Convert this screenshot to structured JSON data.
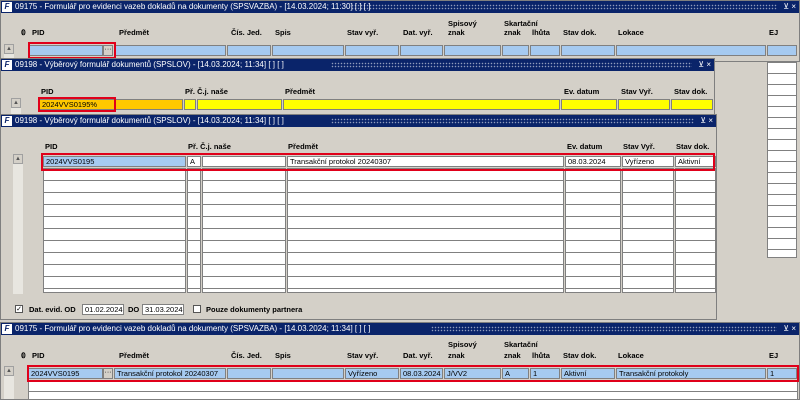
{
  "win_top": {
    "title": "09175 - Formulář pro evidenci vazeb dokladů na dokumenty (SPSVAZBA) - [14.03.2024; 11:30]  [ ]  [ ]",
    "icons": "⊻ ×",
    "headers": {
      "pid": "PID",
      "predmet": "Předmět",
      "cis_jed": "Čís. Jed.",
      "spis": "Spis",
      "stav_vyr": "Stav vyř.",
      "dat_vyr": "Dat. vyř.",
      "spisovy": "Spisový",
      "znak": "znak",
      "skartacni": "Skartační",
      "znak2": "znak",
      "lhuta": "lhůta",
      "stav_dok": "Stav dok.",
      "lokace": "Lokace",
      "ej": "EJ"
    },
    "pid_value": "",
    "ellipsis": "···"
  },
  "win_mid1": {
    "title": "09198 - Výběrový formulář dokumentů (SPSLOV) - [14.03.2024; 11:34]  [ ]  [ ]",
    "icons": "⊻ ×",
    "headers": {
      "pid": "PID",
      "pr_cj": "Př. Č.j. naše",
      "predmet": "Předmět",
      "ev_datum": "Ev. datum",
      "stav_vyr": "Stav Vyř.",
      "stav_dok": "Stav dok."
    },
    "pid_value": "2024VVS0195%"
  },
  "win_mid2": {
    "title": "09198 - Výběrový formulář dokumentů (SPSLOV) - [14.03.2024; 11:34]  [ ]  [ ]",
    "icons": "⊻ ×",
    "headers": {
      "pid": "PID",
      "pr_cj": "Př. Č.j. naše",
      "predmet": "Předmět",
      "ev_datum": "Ev. datum",
      "stav_vyr": "Stav Vyř.",
      "stav_dok": "Stav dok."
    },
    "row": {
      "pid": "2024VVS0195",
      "pr": "A",
      "cj": "",
      "predmet": "Transakční protokol 20240307",
      "ev_datum": "08.03.2024",
      "stav_vyr": "Vyřízeno",
      "stav_dok": "Aktivní"
    },
    "footer": {
      "checkbox_mark": "✓",
      "dat_evid_od": "Dat. evid. OD",
      "od_value": "01.02.2024",
      "do_label": "DO",
      "do_value": "31.03.2024",
      "pouze": "Pouze dokumenty partnera"
    }
  },
  "win_bottom": {
    "title": "09175 - Formulář pro evidenci vazeb dokladů na dokumenty (SPSVAZBA) - [14.03.2024; 11:34]  [ ]  [ ]",
    "icons": "⊻ ×",
    "headers": {
      "pid": "PID",
      "predmet": "Předmět",
      "cis_jed": "Čís. Jed.",
      "spis": "Spis",
      "stav_vyr": "Stav vyř.",
      "dat_vyr": "Dat. vyř.",
      "spisovy": "Spisový",
      "znak": "znak",
      "skartacni": "Skartační",
      "znak2": "znak",
      "lhuta": "lhůta",
      "stav_dok": "Stav dok.",
      "lokace": "Lokace",
      "ej": "EJ"
    },
    "row": {
      "pid": "2024VVS0195",
      "ellipsis": "···",
      "predmet": "Transakční protokol 20240307",
      "cis_jed": "",
      "spis": "",
      "stav_vyr": "Vyřízeno",
      "dat_vyr": "08.03.2024",
      "spisovy": "J/VV2",
      "skart_znak": "A",
      "lhuta": "1",
      "stav_dok": "Aktivní",
      "lokace": "Transakční protokoly",
      "ej": "1"
    }
  },
  "colors": {
    "titlebar": "#0a246a",
    "window": "#d4d0c8",
    "selected": "#a6caf0",
    "query": "#ffff00",
    "highlight": "#e0001a"
  }
}
